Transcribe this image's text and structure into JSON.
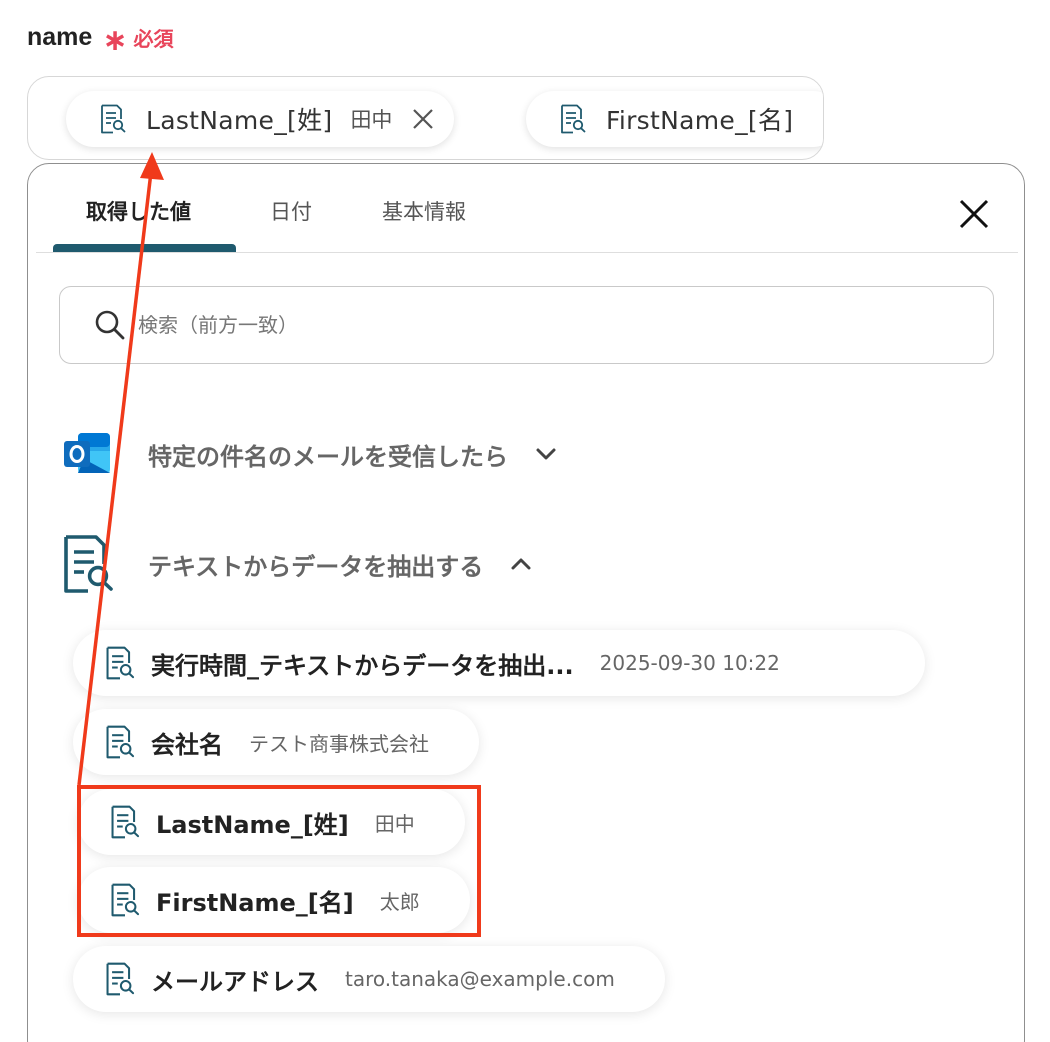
{
  "field": {
    "label": "name",
    "required_star": "∗",
    "required_text": "必須"
  },
  "input_chips": [
    {
      "label": "LastName_[姓]",
      "value": "田中"
    },
    {
      "label": "FirstName_[名]",
      "value": ""
    }
  ],
  "tabs": [
    {
      "label": "取得した値",
      "active": true
    },
    {
      "label": "日付",
      "active": false
    },
    {
      "label": "基本情報",
      "active": false
    }
  ],
  "search": {
    "placeholder": "検索（前方一致）"
  },
  "sections": [
    {
      "title": "特定の件名のメールを受信したら",
      "expanded": false,
      "icon": "outlook-icon"
    },
    {
      "title": "テキストからデータを抽出する",
      "expanded": true,
      "icon": "text-extract-icon"
    }
  ],
  "items": [
    {
      "label": "実行時間_テキストからデータを抽出...",
      "value": "2025-09-30 10:22"
    },
    {
      "label": "会社名",
      "value": "テスト商事株式会社"
    },
    {
      "label": "LastName_[姓]",
      "value": "田中"
    },
    {
      "label": "FirstName_[名]",
      "value": "太郎"
    },
    {
      "label": "メールアドレス",
      "value": "taro.tanaka@example.com"
    }
  ],
  "colors": {
    "accent": "#1f5a6e",
    "required": "#e8455b",
    "annotation": "#f03a1b",
    "outlook_blue": "#0f6cbd"
  }
}
